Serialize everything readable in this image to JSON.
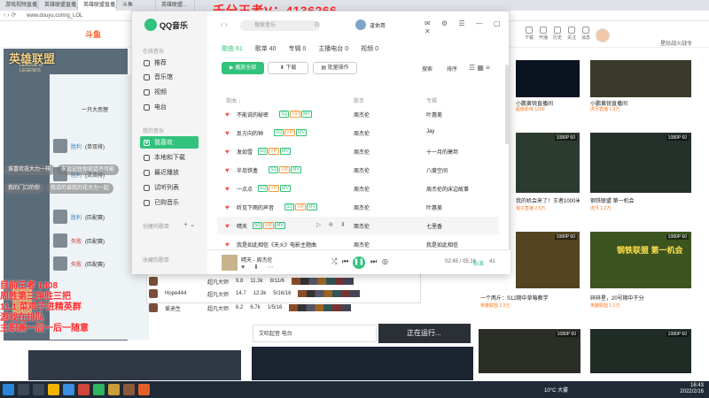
{
  "watermark": "千分王者V：4136266",
  "browser": {
    "tabs": [
      "游戏视频直播_英",
      "英雄联盟直播_lol",
      "英雄联盟直播_英",
      "斗鱼",
      "英雄联盟..."
    ],
    "url": "www.douyu.com/g_LOL"
  },
  "douyu": {
    "logo": "斗鱼",
    "header_icons": [
      "下载",
      "开播",
      "历史",
      "关注",
      "消息",
      "任务"
    ],
    "promo": "星际战火战令"
  },
  "game": {
    "banner": "英雄联盟",
    "banner_sub": "LEAGUE of LEGENDS",
    "client_title": "一只大恶狸",
    "roster": [
      {
        "name": "胜利",
        "rank": "(单双排)"
      },
      {
        "name": "胜利",
        "rank": "(灵活排)"
      },
      {
        "name": "胜利",
        "rank": "(匹配赛)"
      },
      {
        "name": "失败",
        "rank": "(匹配赛)"
      },
      {
        "name": "失败",
        "rank": "(匹配赛)"
      },
      {
        "name": "胜利",
        "rank": "(匹配赛)"
      },
      {
        "name": "胜利",
        "rank": "(灵活排)"
      },
      {
        "name": "胜利",
        "rank": "(匹配赛)"
      }
    ],
    "stats": [
      {
        "player": "",
        "rank": "超凡大师",
        "kda": "9.8",
        "gold": "11.3k",
        "score": "8/11/6"
      },
      {
        "player": "Hope444",
        "rank": "超凡大师",
        "kda": "14.7",
        "gold": "12.3k",
        "score": "5/16/16"
      },
      {
        "player": "爱迪生",
        "rank": "超凡大师",
        "kda": "6.2",
        "gold": "6.7k",
        "score": "1/5/16"
      }
    ]
  },
  "overlay": {
    "lines": [
      "目前王者 1408",
      "周胜第三净胜三把",
      "11.1 菜鸡子进精英群",
      "游戏在排队",
      "主职兼一后一后一随意"
    ],
    "chat": [
      "谁喜欢花大力一样",
      "永远记住你说话不可能",
      "我的门口的你",
      "我说的谁我的花大力一起"
    ]
  },
  "bottom": {
    "music_strip": "艾吹起音 电台",
    "running": "正在运行..."
  },
  "qqmusic": {
    "app_name": "QQ音乐",
    "search_placeholder": "搜索音乐",
    "sidebar": {
      "g1": "在线音乐",
      "items": [
        "推荐",
        "音乐馆",
        "视频",
        "电台"
      ],
      "g2": "我的音乐",
      "my": [
        "我喜欢",
        "本地和下载",
        "最近播放",
        "试听列表",
        "已购音乐"
      ],
      "g3": "创建的歌单",
      "g4": "收藏的歌单"
    },
    "user": "逢佑哥",
    "tabs": [
      "歌曲 61",
      "歌单 40",
      "专辑 0",
      "主播电台 0",
      "视频 0"
    ],
    "buttons": {
      "play_all": "▶ 播放全部",
      "download": "⬇ 下载",
      "batch": "▤ 批量操作",
      "search": "搜索",
      "sort": "排序"
    },
    "headers": {
      "song": "歌曲 ↓",
      "artist": "歌手",
      "album": "专辑"
    },
    "songs": [
      {
        "title": "不能说的秘密",
        "artist": "周杰伦",
        "album": "叶惠美"
      },
      {
        "title": "反方向的钟",
        "artist": "周杰伦",
        "album": "Jay"
      },
      {
        "title": "发如雪",
        "artist": "周杰伦",
        "album": "十一月的萧邦"
      },
      {
        "title": "半岛铁盒",
        "artist": "周杰伦",
        "album": "八度空间"
      },
      {
        "title": "一点点",
        "artist": "周杰伦",
        "album": "周杰伦的床边故事"
      },
      {
        "title": "听见下雨的声音",
        "artist": "周杰伦",
        "album": "叶惠美"
      },
      {
        "title": "晴天",
        "artist": "周杰伦",
        "album": "七里香"
      },
      {
        "title": "我是如此相信《天火》电影主题曲",
        "artist": "周杰伦",
        "album": "我是如此相信"
      }
    ],
    "player": {
      "title": "晴天",
      "artist": "周杰伦",
      "time": "02:45 / 05:16",
      "quality": "标准",
      "count": "41"
    }
  },
  "streams": [
    {
      "title": "小鹏黄锐直播间",
      "tag": "超级影响 1200",
      "views": "",
      "up": "英雄联盟"
    },
    {
      "title": "小鹏黄锐直播间",
      "tag": "虎牙直播 1.9万",
      "views": "",
      "up": "英雄联盟"
    },
    {
      "title": "我的机会来了！王者1000米...",
      "tag": "猴子直播 2.5万",
      "views": "",
      "up": "英雄联盟"
    },
    {
      "title": "钢铁联盟 第一机会",
      "tag": "虎牙 1.2万",
      "views": "",
      "up": "英雄联盟"
    },
    {
      "title": "一个两斤：S12期中草莓教学",
      "tag": "英雄联盟 2.3万",
      "views": "",
      "up": "英雄联盟"
    },
    {
      "title": "碎碎星，20号期中干分",
      "tag": "英雄联盟 1.1万",
      "views": "",
      "up": "英雄联盟"
    }
  ],
  "taskbar": {
    "weather": "10°C 大雾",
    "time": "16:43",
    "date": "2022/2/16"
  }
}
